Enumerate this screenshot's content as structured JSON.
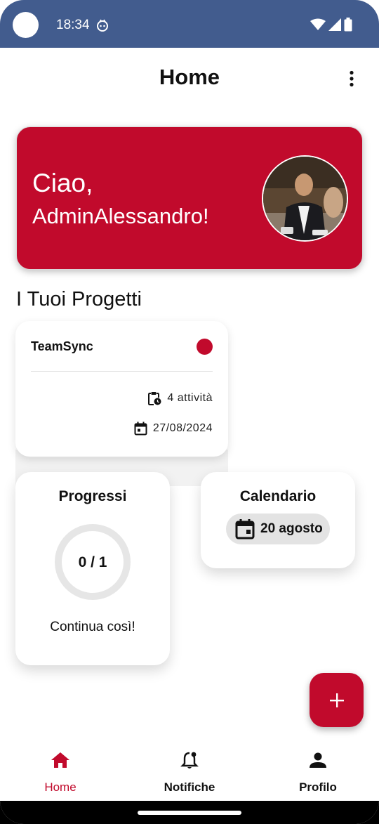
{
  "status_bar": {
    "time": "18:34",
    "icons": [
      "camera-dot",
      "app-notification-icon",
      "wifi-icon",
      "signal-icon",
      "battery-icon"
    ]
  },
  "app_bar": {
    "title": "Home",
    "menu_icon": "more-vert-icon"
  },
  "greeting": {
    "hello": "Ciao,",
    "name": "AdminAlessandro!",
    "avatar_icon": "user-photo"
  },
  "projects": {
    "section_title": "I Tuoi Progetti",
    "items": [
      {
        "name": "TeamSync",
        "status_color": "#c10a2c",
        "tasks": "4 attività",
        "date": "27/08/2024"
      }
    ]
  },
  "progress": {
    "title": "Progressi",
    "value": "0 / 1",
    "completed": 0,
    "total": 1,
    "caption": "Continua così!"
  },
  "calendar": {
    "title": "Calendario",
    "date": "20 agosto"
  },
  "fab": {
    "icon": "plus-icon"
  },
  "bottom_nav": {
    "items": [
      {
        "label": "Home",
        "icon": "home-icon",
        "active": true
      },
      {
        "label": "Notifiche",
        "icon": "bell-icon",
        "active": false
      },
      {
        "label": "Profilo",
        "icon": "person-icon",
        "active": false
      }
    ]
  },
  "colors": {
    "accent": "#c10a2c",
    "status_bar": "#425c8e",
    "chip": "#e3e3e3"
  }
}
